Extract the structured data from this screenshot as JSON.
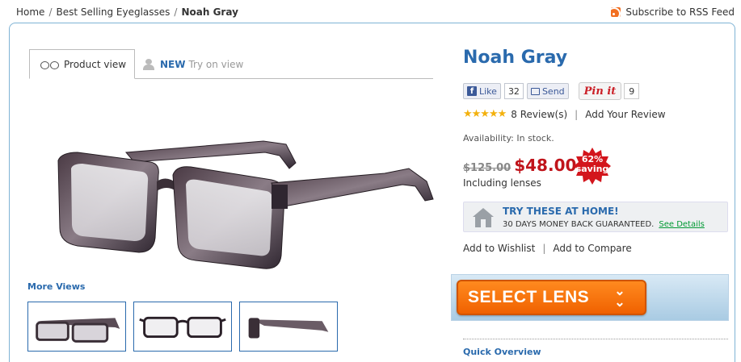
{
  "breadcrumb": {
    "home": "Home",
    "category": "Best Selling Eyeglasses",
    "current": "Noah Gray",
    "separator": "/"
  },
  "rss": {
    "label": "Subscribe to RSS Feed",
    "icon": "rss-icon"
  },
  "tabs": {
    "product_view": "Product view",
    "try_new": "NEW",
    "try_label": "Try on view"
  },
  "more_views": "More Views",
  "product": {
    "name": "Noah Gray",
    "rating_stars": "★★★★★",
    "reviews": "8 Review(s)",
    "add_review": "Add Your Review",
    "availability": "Availability: In stock.",
    "old_price": "$125.00",
    "price": "$48.00",
    "discount_pct": "62%",
    "discount_word": "saving",
    "including": "Including lenses"
  },
  "social": {
    "like": "Like",
    "like_count": "32",
    "send": "Send",
    "pinit": "Pin it",
    "pin_count": "9"
  },
  "try_home": {
    "title": "TRY THESE AT HOME!",
    "subtitle": "30 DAYS MONEY BACK GUARANTEED.",
    "link": "See Details"
  },
  "actions": {
    "wishlist": "Add to Wishlist",
    "compare": "Add to Compare",
    "select_lens": "SELECT LENS"
  },
  "quick_overview": "Quick Overview",
  "colors": {
    "accent_blue": "#2a6aad",
    "price_red": "#c0141b",
    "orange": "#f06100",
    "star_gold": "#f3b10d"
  }
}
